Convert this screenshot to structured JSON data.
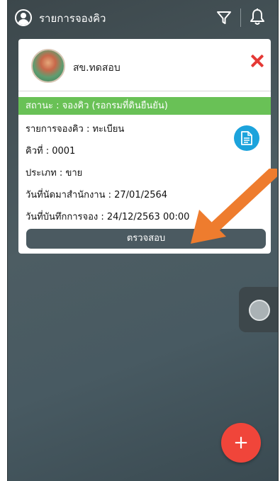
{
  "header": {
    "title": "รายการจองคิว",
    "user_icon": "user-circle-icon",
    "filter_icon": "filter-icon",
    "bell_icon": "bell-icon"
  },
  "card": {
    "branch": "สข.ทดสอบ",
    "status": "สถานะ : จองคิว (รอกรมที่ดินยืนยัน)",
    "fields": [
      "รายการจองคิว : ทะเบียน",
      "คิวที่ : 0001",
      "ประเภท : ขาย",
      "วันที่นัดมาสำนักงาน : 27/01/2564",
      "วันที่บันทึกการจอง : 24/12/2563 00:00"
    ],
    "check_label": "ตรวจสอบ"
  },
  "fab": {
    "label": "+"
  },
  "colors": {
    "status_green": "#69c156",
    "fab_red": "#f0453a",
    "doc_blue": "#1ca3dc",
    "annotation_orange": "#ee7c2e"
  }
}
